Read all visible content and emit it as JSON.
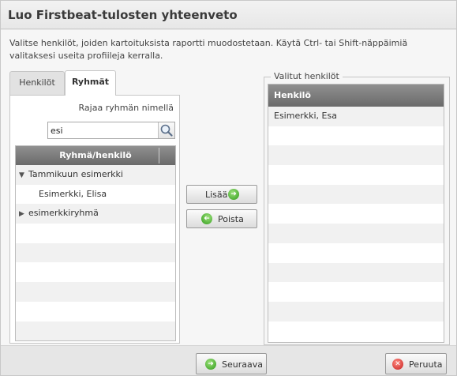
{
  "dialog": {
    "title": "Luo Firstbeat-tulosten yhteenveto",
    "instructions": "Valitse henkilöt, joiden kartoituksista raportti muodostetaan. Käytä Ctrl- tai Shift-näppäimiä valitaksesi useita profiileja kerralla."
  },
  "tabs": [
    {
      "label": "Henkilöt",
      "active": false
    },
    {
      "label": "Ryhmät",
      "active": true
    }
  ],
  "groups_panel": {
    "filter_label": "Rajaa ryhmän nimellä",
    "search_value": "esi",
    "search_icon": "magnifier-icon",
    "column_header": "Ryhmä/henkilö",
    "rows": [
      {
        "label": "Tammikuun esimerkki",
        "type": "group",
        "expanded": true
      },
      {
        "label": "Esimerkki, Elisa",
        "type": "person"
      },
      {
        "label": "esimerkkiryhmä",
        "type": "group",
        "expanded": false
      }
    ]
  },
  "actions": {
    "add_label": "Lisää",
    "remove_label": "Poista"
  },
  "selected": {
    "legend": "Valitut henkilöt",
    "column_header": "Henkilö",
    "rows": [
      "Esimerkki, Esa"
    ]
  },
  "footer": {
    "next_label": "Seuraava",
    "cancel_label": "Peruuta"
  }
}
